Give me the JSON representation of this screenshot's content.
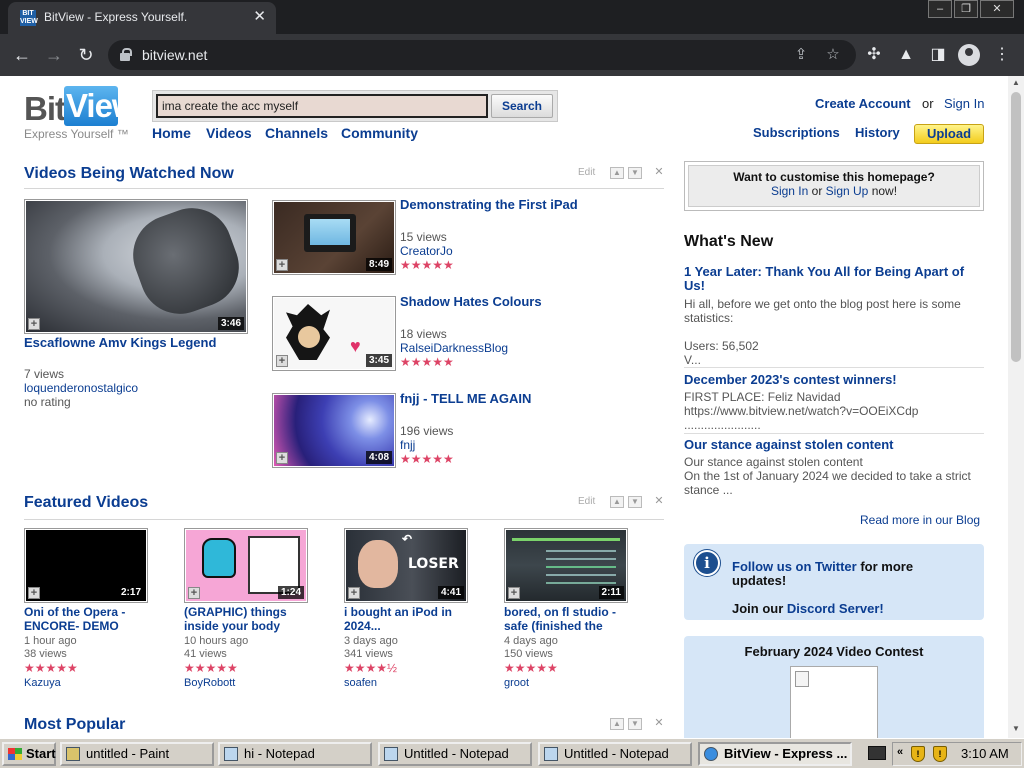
{
  "browser": {
    "tab_title": "BitView - Express Yourself.",
    "favicon_text": "BIT VIEW",
    "url": "bitview.net",
    "window_buttons": [
      "–",
      "❐",
      "✕"
    ]
  },
  "site": {
    "logo_bit": "Bit",
    "logo_view": "View",
    "tagline": "Express Yourself ™",
    "search": {
      "value": "ima create the acc myself",
      "button": "Search"
    },
    "nav": [
      "Home",
      "Videos",
      "Channels",
      "Community"
    ],
    "account": {
      "create": "Create Account",
      "or": "or",
      "sign_in": "Sign In"
    },
    "subscriptions": "Subscriptions",
    "history": "History",
    "upload": "Upload"
  },
  "watched_now": {
    "title": "Videos Being Watched Now",
    "edit": "Edit",
    "main": {
      "title": "Escaflowne Amv Kings Legend",
      "duration": "3:46",
      "views": "7 views",
      "user": "loquenderonostalgico",
      "rating": "no rating"
    },
    "items": [
      {
        "title": "Demonstrating the First iPad",
        "duration": "8:49",
        "views": "15 views",
        "user": "CreatorJo",
        "stars": "★★★★★"
      },
      {
        "title": "Shadow Hates Colours",
        "duration": "3:45",
        "views": "18 views",
        "user": "RalseiDarknessBlog",
        "stars": "★★★★★"
      },
      {
        "title": "fnjj - TELL ME AGAIN",
        "duration": "4:08",
        "views": "196 views",
        "user": "fnjj",
        "stars": "★★★★★"
      }
    ]
  },
  "featured": {
    "title": "Featured Videos",
    "edit": "Edit",
    "items": [
      {
        "title_line1": "Oni of the Opera -",
        "title_line2": "ENCORE- DEMO",
        "duration": "2:17",
        "age": "1 hour ago",
        "views": "38 views",
        "user": "Kazuya",
        "stars": "★★★★★"
      },
      {
        "title_line1": "(GRAPHIC) things",
        "title_line2": "inside your body",
        "duration": "1:24",
        "age": "10 hours ago",
        "views": "41 views",
        "user": "BoyRobott",
        "stars": "★★★★★"
      },
      {
        "title_line1": "i bought an iPod in",
        "title_line2": "2024...",
        "duration": "4:41",
        "age": "3 days ago",
        "views": "341 views",
        "user": "soafen",
        "stars": "★★★★½",
        "thumb_text": "LOSER"
      },
      {
        "title_line1": "bored, on fl studio -",
        "title_line2": "safe (finished the",
        "duration": "2:11",
        "age": "4 days ago",
        "views": "150 views",
        "user": "groot",
        "stars": "★★★★★"
      }
    ]
  },
  "most_popular": {
    "title": "Most Popular"
  },
  "sidebar": {
    "customise": {
      "question": "Want to customise this homepage?",
      "sign_in": "Sign In",
      "or": "or",
      "sign_up": "Sign Up",
      "now": "now!"
    },
    "whats_new": "What's New",
    "posts": [
      {
        "title": "1 Year Later: Thank You All for Being Apart of Us!",
        "body": "Hi all, before we get onto the blog post here is some statistics:\n\nUsers: 56,502\nV..."
      },
      {
        "title": "December 2023's contest winners!",
        "body": "FIRST PLACE: Feliz Navidad\nhttps://www.bitview.net/watch?v=OOEiXCdp\n......................."
      },
      {
        "title": "Our stance against stolen content",
        "body": "Our stance against stolen content\nOn the 1st of January 2024 we decided to take a strict stance ..."
      }
    ],
    "read_more": "Read more in our Blog",
    "twitter": {
      "icon": "i",
      "follow": "Follow us on Twitter",
      "more": "for more",
      "updates": "updates!",
      "join": "Join our",
      "discord": "Discord Server!"
    },
    "contest": {
      "title": "February 2024 Video Contest"
    }
  },
  "taskbar": {
    "start": "Start",
    "tasks": [
      "untitled - Paint",
      "hi - Notepad",
      "Untitled - Notepad",
      "Untitled - Notepad",
      "BitView - Express ..."
    ],
    "tray_arrow": "«",
    "clock": "3:10 AM"
  },
  "colors": {
    "link": "#0b3d91",
    "upload_button": "#f3cc1d",
    "sidebar_box": "#d6e6f7",
    "stars": "#dd4466"
  }
}
